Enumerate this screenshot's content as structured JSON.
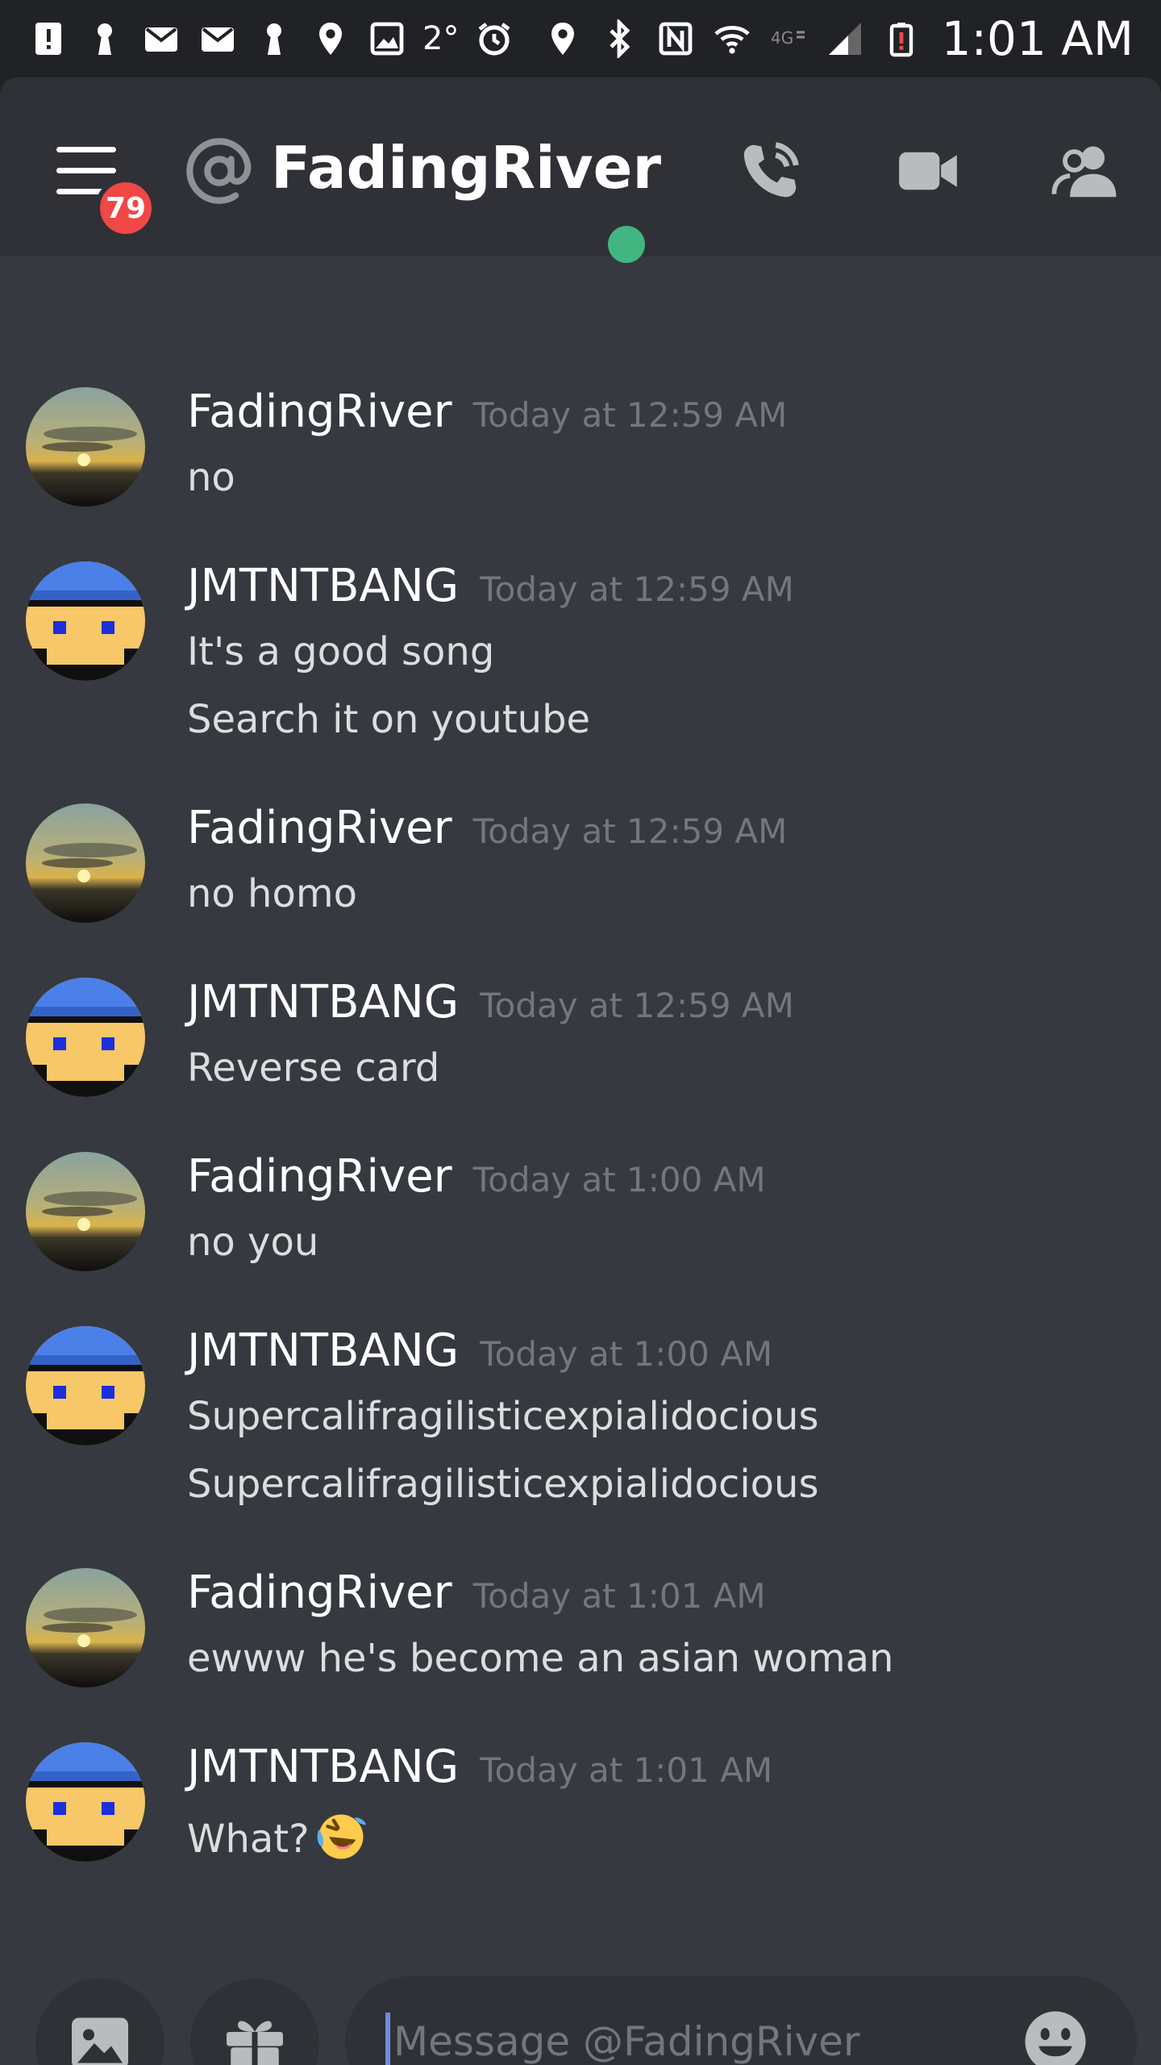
{
  "status_bar": {
    "temperature": "2°",
    "time": "1:01 AM",
    "left_icons": [
      "alert-icon",
      "keyhole-icon",
      "mail-icon",
      "mail-icon",
      "keyhole-icon",
      "location-icon",
      "image-icon"
    ],
    "right_icons": [
      "location-icon",
      "bluetooth-icon",
      "nfc-icon",
      "wifi-icon",
      "4g-lte-icon",
      "signal-icon",
      "battery-low-icon"
    ]
  },
  "header": {
    "unread_badge": "79",
    "title": "FadingRiver",
    "online_color": "#43b581",
    "actions": [
      "call-icon",
      "video-icon",
      "members-icon"
    ]
  },
  "messages": [
    {
      "author": "FadingRiver",
      "timestamp": "Today at 12:59 AM",
      "lines": [
        "no"
      ],
      "avatar": "sunset"
    },
    {
      "author": "JMTNTBANG",
      "timestamp": "Today at 12:59 AM",
      "lines": [
        "It's a good song",
        "Search it on youtube"
      ],
      "avatar": "pixel-face"
    },
    {
      "author": "FadingRiver",
      "timestamp": "Today at 12:59 AM",
      "lines": [
        "no homo"
      ],
      "avatar": "sunset"
    },
    {
      "author": "JMTNTBANG",
      "timestamp": "Today at 12:59 AM",
      "lines": [
        "Reverse card"
      ],
      "avatar": "pixel-face"
    },
    {
      "author": "FadingRiver",
      "timestamp": "Today at 1:00 AM",
      "lines": [
        "no you"
      ],
      "avatar": "sunset"
    },
    {
      "author": "JMTNTBANG",
      "timestamp": "Today at 1:00 AM",
      "lines": [
        "Supercalifragilisticexpialidocious",
        "Supercalifragilisticexpialidocious"
      ],
      "avatar": "pixel-face"
    },
    {
      "author": "FadingRiver",
      "timestamp": "Today at 1:01 AM",
      "lines": [
        "ewww he's become an asian woman"
      ],
      "avatar": "sunset"
    },
    {
      "author": "JMTNTBANG",
      "timestamp": "Today at 1:01 AM",
      "lines": [
        "What?"
      ],
      "avatar": "pixel-face",
      "emoji": "rolling-on-floor-laughing"
    }
  ],
  "composer": {
    "placeholder": "Message @FadingRiver",
    "buttons": [
      "image-icon",
      "gift-icon",
      "emoji-icon"
    ]
  },
  "colors": {
    "background": "#36393f",
    "header": "#2f3136",
    "status_bar": "#202225",
    "badge": "#f04747",
    "caret": "#7289da"
  }
}
